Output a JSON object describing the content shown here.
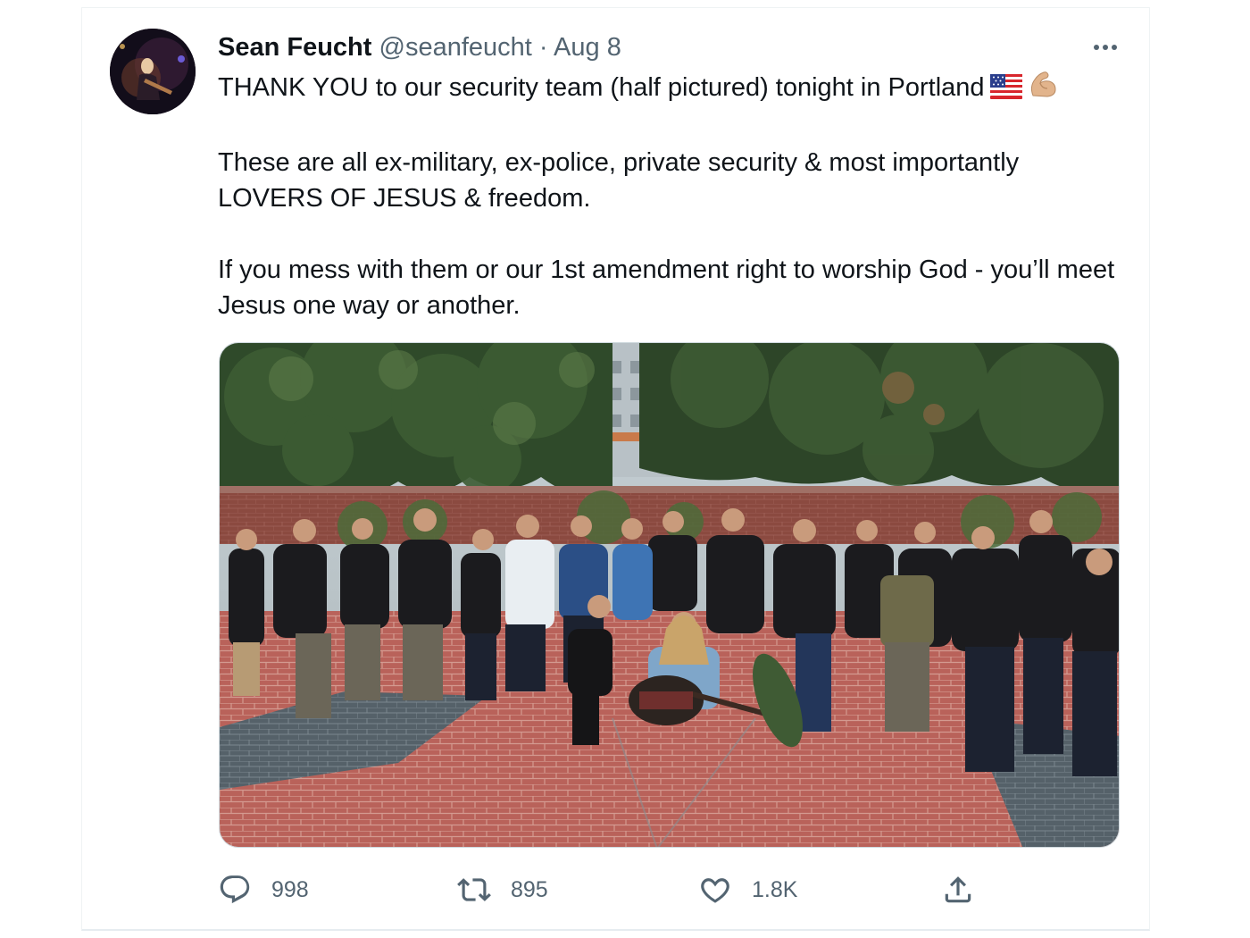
{
  "tweet": {
    "author_name": "Sean Feucht",
    "handle": "@seanfeucht",
    "separator": "·",
    "date": "Aug 8",
    "text_line1": "THANK YOU to our security team (half pictured) tonight in Portland",
    "text_para2": "These are all ex-military, ex-police, private security & most importantly LOVERS OF JESUS & freedom.",
    "text_para3": "If you mess with them or our 1st amendment right to worship God - you’ll meet Jesus one way or another.",
    "emojis": [
      "us-flag-icon",
      "flexed-biceps-icon"
    ]
  },
  "actions": {
    "reply_count": "998",
    "retweet_count": "895",
    "like_count": "1.8K"
  },
  "colors": {
    "text": "#0f1419",
    "muted": "#536471",
    "border": "#eff3f4"
  }
}
